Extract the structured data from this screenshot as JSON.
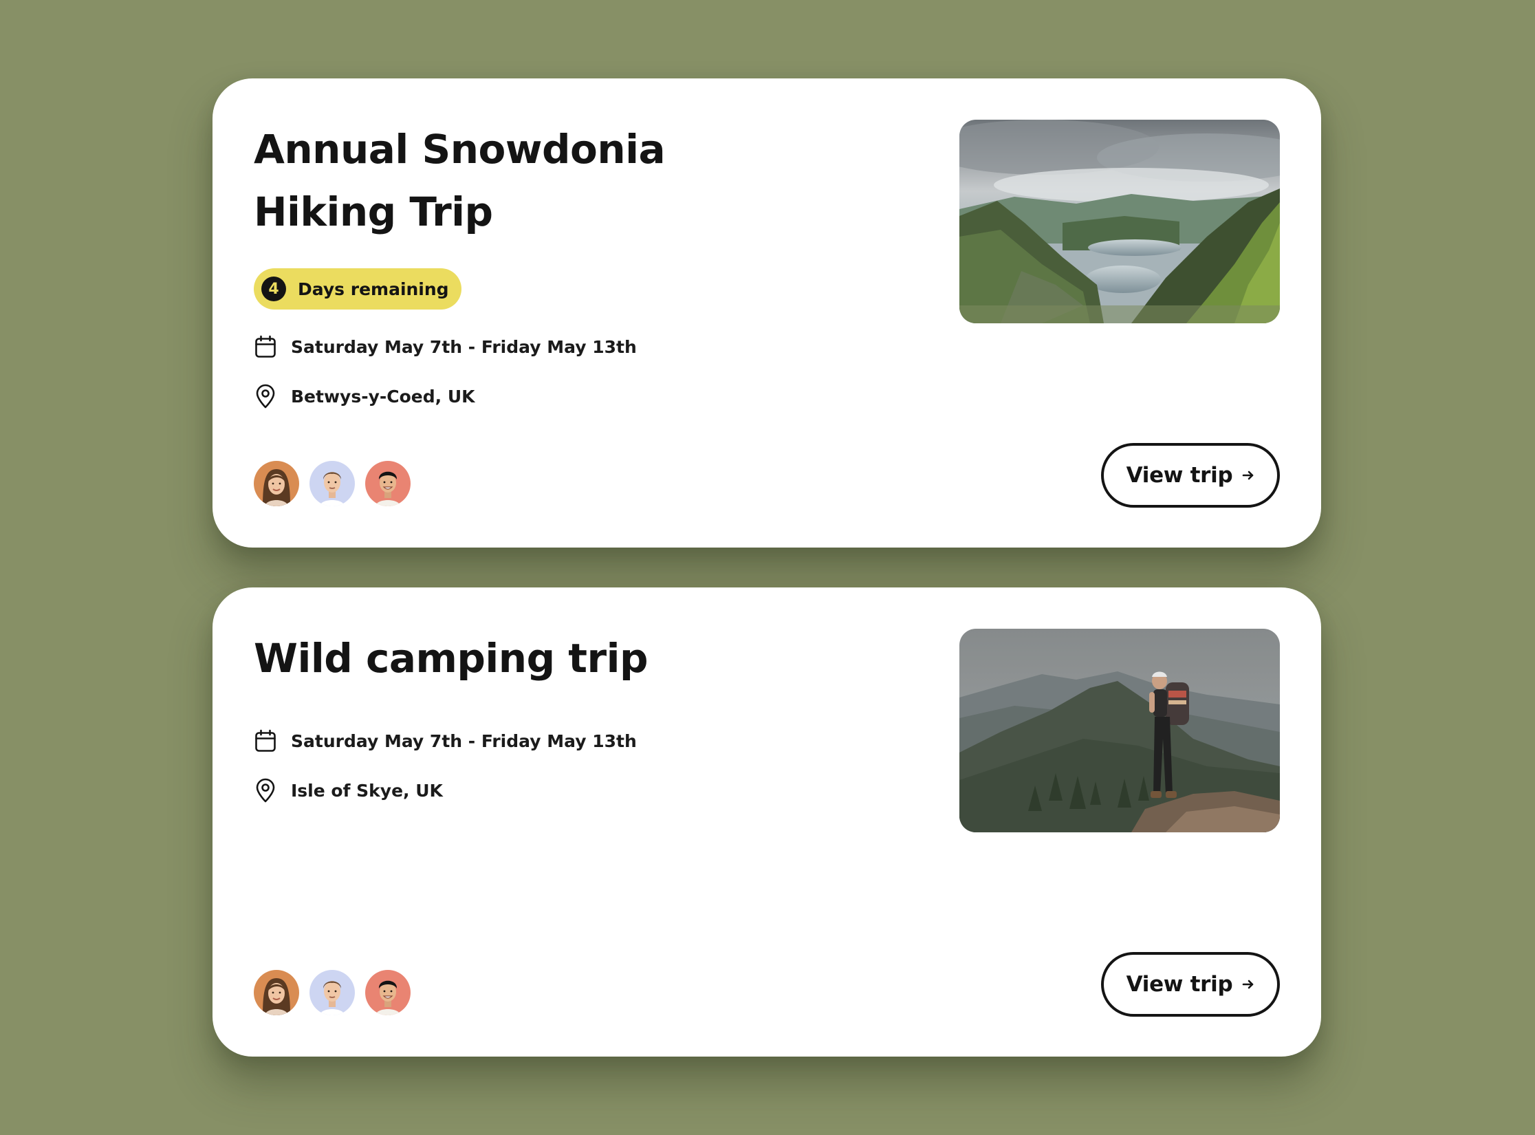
{
  "colors": {
    "background": "#879066",
    "card": "#ffffff",
    "badge": "#ebdc5f",
    "text": "#141414"
  },
  "trips": [
    {
      "title": "Annual Snowdonia Hiking Trip",
      "badge": {
        "count": "4",
        "label": "Days remaining"
      },
      "dates": "Saturday May 7th - Friday May 13th",
      "location": "Betwys-y-Coed, UK",
      "image": "mountain-lake-landscape-photo",
      "avatars": [
        "woman-avatar",
        "man-avatar",
        "smiling-man-avatar"
      ],
      "button_label": "View trip"
    },
    {
      "title": "Wild camping trip",
      "dates": "Saturday May 7th - Friday May 13th",
      "location": "Isle of Skye, UK",
      "image": "hiker-on-mountain-photo",
      "avatars": [
        "woman-avatar",
        "man-avatar",
        "smiling-man-avatar"
      ],
      "button_label": "View trip"
    }
  ]
}
